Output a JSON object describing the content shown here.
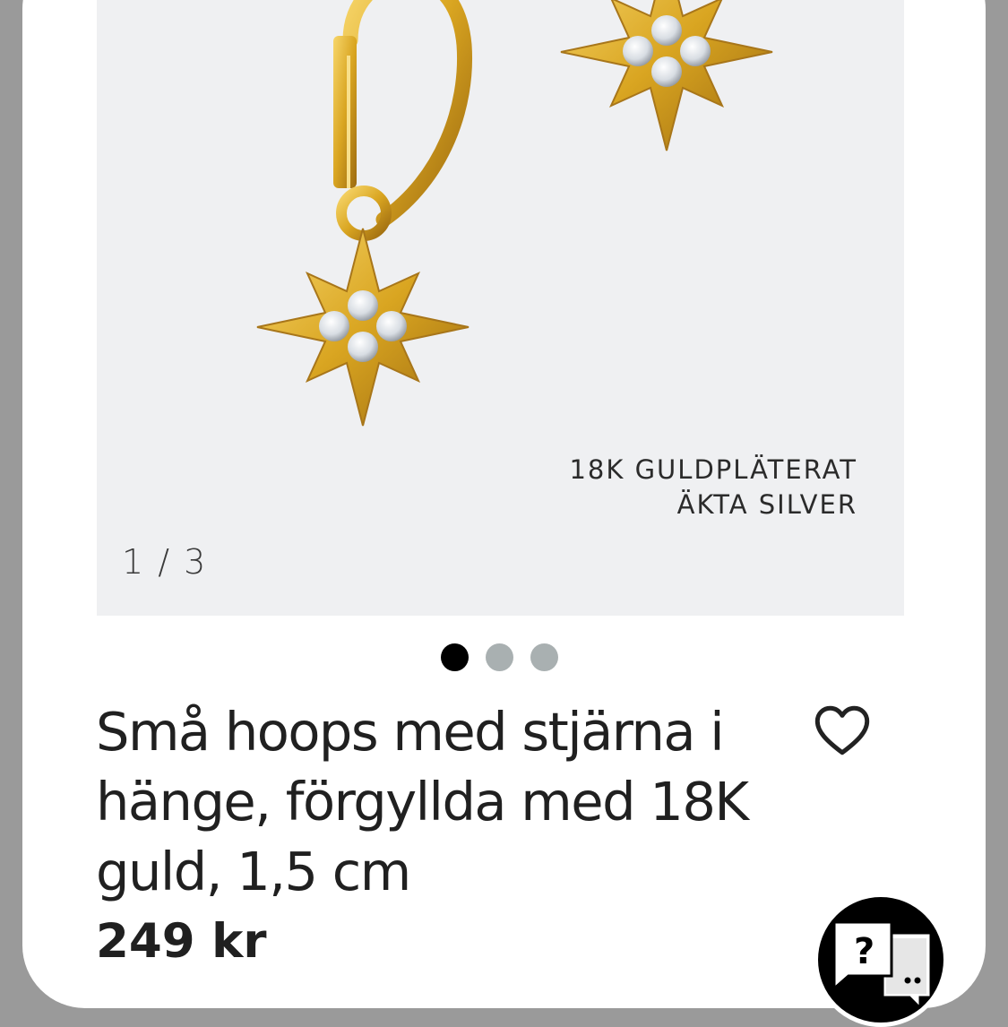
{
  "gallery": {
    "counter": "1 / 3",
    "caption_line1": "18K GULDPLÄTERAT",
    "caption_line2": "ÄKTA SILVER",
    "total_images": 3,
    "active_index": 0
  },
  "product": {
    "title": "Små hoops med stjärna i hänge, förgyllda med 18K guld, 1,5 cm",
    "price": "249 kr"
  },
  "icons": {
    "favorite": "heart-outline-icon",
    "chat": "chat-help-icon"
  },
  "colors": {
    "image_bg": "#eff0f2",
    "dot_active": "#000000",
    "dot_inactive": "#a9b0b1",
    "gold": "#d9a521",
    "text": "#202020"
  }
}
